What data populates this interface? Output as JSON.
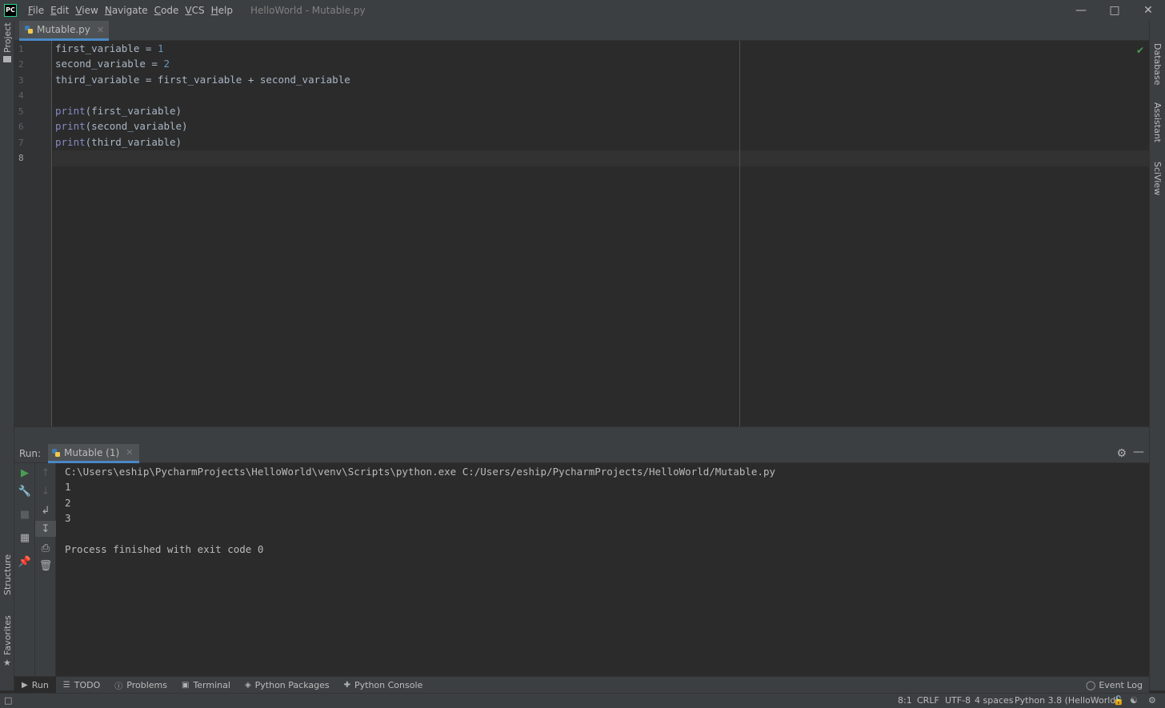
{
  "app": {
    "logo_text": "PC",
    "window_title": "HelloWorld - Mutable.py",
    "menu": [
      "File",
      "Edit",
      "View",
      "Navigate",
      "Code",
      "VCS",
      "Help"
    ]
  },
  "editor": {
    "tab_label": "Mutable.py",
    "line_numbers": [
      "1",
      "2",
      "3",
      "4",
      "5",
      "6",
      "7",
      "8"
    ],
    "lines": [
      {
        "pre": "first_variable = ",
        "num": "1",
        "post": ""
      },
      {
        "pre": "second_variable = ",
        "num": "2",
        "post": ""
      },
      {
        "pre": "third_variable = first_variable + second_variable",
        "num": "",
        "post": ""
      },
      {
        "pre": "",
        "num": "",
        "post": ""
      },
      {
        "kw": "print",
        "rest": "(first_variable)"
      },
      {
        "kw": "print",
        "rest": "(second_variable)"
      },
      {
        "kw": "print",
        "rest": "(third_variable)"
      },
      {
        "pre": "",
        "num": "",
        "post": ""
      }
    ],
    "cursor_line": "8"
  },
  "side_left": {
    "project": "Project",
    "structure": "Structure",
    "favorites": "Favorites"
  },
  "side_right": {
    "database": "Database",
    "assistant": "Assistant",
    "sciview": "SciView"
  },
  "run_panel": {
    "title": "Run:",
    "tab_label": "Mutable (1)",
    "output": [
      "C:\\Users\\eship\\PycharmProjects\\HelloWorld\\venv\\Scripts\\python.exe C:/Users/eship/PycharmProjects/HelloWorld/Mutable.py",
      "1",
      "2",
      "3",
      "",
      "Process finished with exit code 0"
    ]
  },
  "bottom_tools": {
    "run": "Run",
    "todo": "TODO",
    "problems": "Problems",
    "terminal": "Terminal",
    "python_packages": "Python Packages",
    "python_console": "Python Console",
    "event_log": "Event Log"
  },
  "status": {
    "position": "8:1",
    "line_sep": "CRLF",
    "encoding": "UTF-8",
    "indent": "4 spaces",
    "interpreter": "Python 3.8 (HelloWorld)"
  }
}
